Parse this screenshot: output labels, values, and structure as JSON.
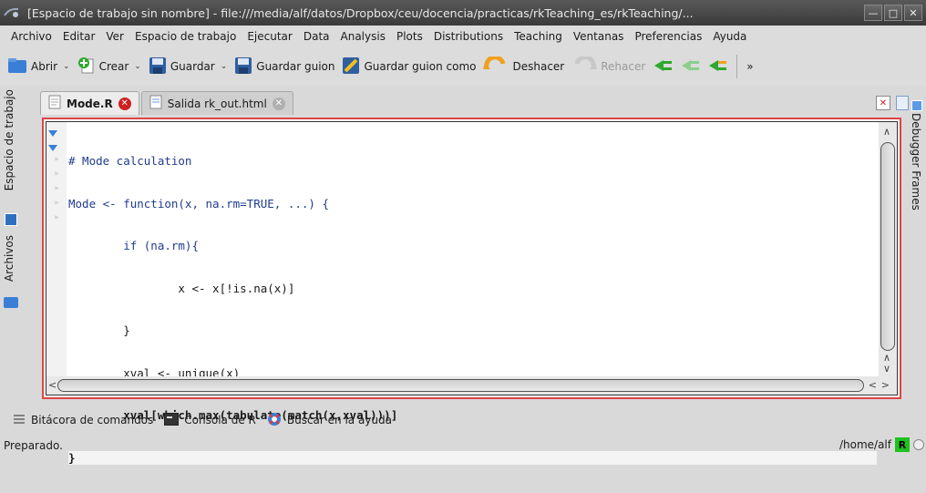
{
  "window": {
    "title": "[Espacio de trabajo sin nombre] - file:///media/alf/datos/Dropbox/ceu/docencia/practicas/rkTeaching_es/rkTeaching/...",
    "min_label": "—",
    "max_label": "□",
    "close_label": "✕"
  },
  "menubar": [
    "Archivo",
    "Editar",
    "Ver",
    "Espacio de trabajo",
    "Ejecutar",
    "Data",
    "Analysis",
    "Plots",
    "Distributions",
    "Teaching",
    "Ventanas",
    "Preferencias",
    "Ayuda"
  ],
  "toolbar": {
    "open": "Abrir",
    "create": "Crear",
    "save": "Guardar",
    "save_script": "Guardar guion",
    "save_script_as": "Guardar guion como",
    "undo": "Deshacer",
    "redo": "Rehacer",
    "overflow": "»"
  },
  "left_panel": {
    "workspace": "Espacio de trabajo",
    "files": "Archivos"
  },
  "right_panel": {
    "debugger": "Debugger Frames"
  },
  "tabs": [
    {
      "label": "Mode.R"
    },
    {
      "label": "Salida rk_out.html"
    }
  ],
  "editor": {
    "lines": [
      "# Mode calculation",
      "Mode <- function(x, na.rm=TRUE, ...) {",
      "        if (na.rm){",
      "                x <- x[!is.na(x)]",
      "        }",
      "        xval <- unique(x)",
      "        xval[which.max(tabulate(match(x,xval)))]",
      "}"
    ]
  },
  "bottom_tabs": [
    "Bitácora de comandos",
    "Consola de R",
    "Buscar en la ayuda"
  ],
  "status": {
    "text": "Preparado.",
    "path": "/home/alf",
    "r_badge": "R"
  },
  "colors": {
    "accent_border": "#dd4444",
    "r_badge": "#1ec21e"
  }
}
